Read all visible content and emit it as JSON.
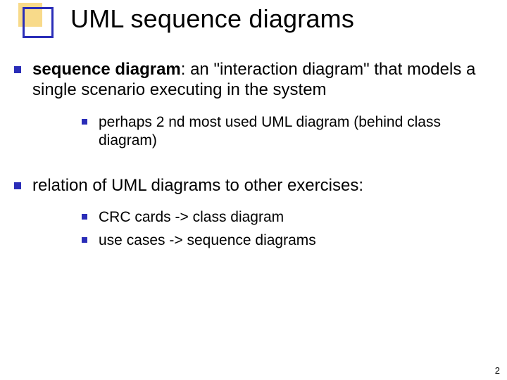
{
  "title": "UML sequence diagrams",
  "bullets": [
    {
      "strong": "sequence diagram",
      "rest": ": an \"interaction diagram\" that models a single scenario executing in the system",
      "sub": [
        "perhaps 2 nd most used UML diagram (behind class diagram)"
      ]
    },
    {
      "strong": "",
      "rest": "relation of UML diagrams to other exercises:",
      "sub": [
        "CRC cards -> class diagram",
        "use cases -> sequence diagrams"
      ]
    }
  ],
  "pageNumber": "2"
}
